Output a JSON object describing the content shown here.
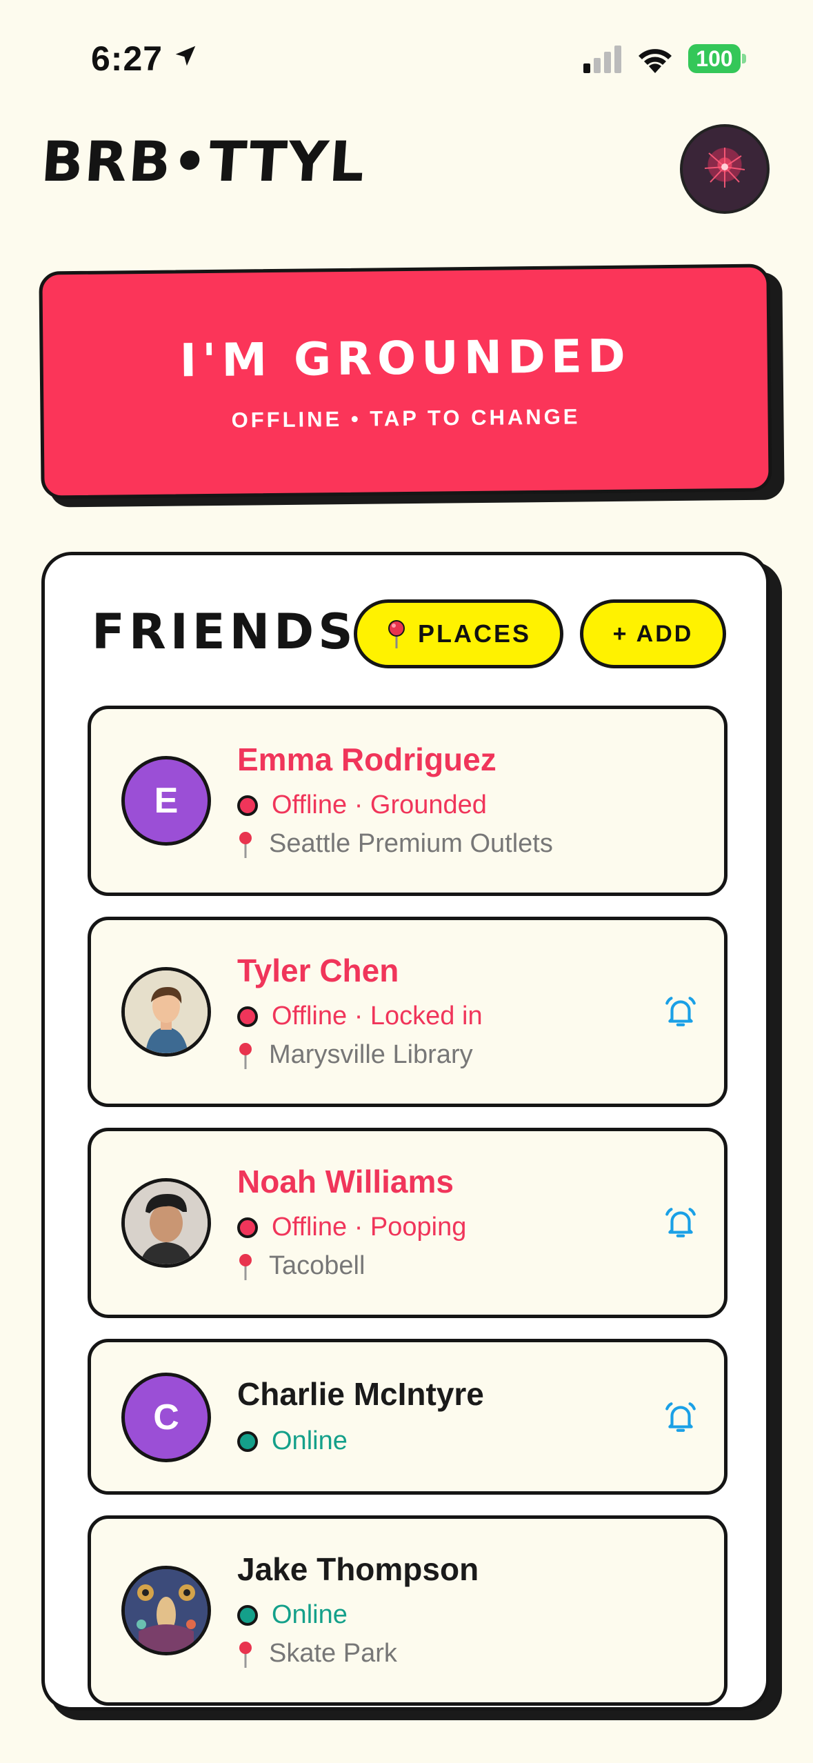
{
  "status_bar": {
    "time": "6:27",
    "battery": "100"
  },
  "header": {
    "title": "BRB•TTYL"
  },
  "status_card": {
    "title": "I'M GROUNDED",
    "subtitle": "OFFLINE • TAP TO CHANGE",
    "color": "#fb3559"
  },
  "friends_panel": {
    "title": "FRIENDS",
    "places_label": "PLACES",
    "add_label": "+ ADD"
  },
  "friends": [
    {
      "name": "Emma Rodriguez",
      "status": "Offline · Grounded",
      "location": "Seattle Premium Outlets",
      "online": false,
      "avatar_letter": "E",
      "bell": false
    },
    {
      "name": "Tyler Chen",
      "status": "Offline · Locked in",
      "location": "Marysville Library",
      "online": false,
      "avatar_letter": "",
      "bell": true
    },
    {
      "name": "Noah Williams",
      "status": "Offline · Pooping",
      "location": "Tacobell",
      "online": false,
      "avatar_letter": "",
      "bell": true
    },
    {
      "name": "Charlie McIntyre",
      "status": "Online",
      "location": "",
      "online": true,
      "avatar_letter": "C",
      "bell": true
    },
    {
      "name": "Jake Thompson",
      "status": "Online",
      "location": "Skate Park",
      "online": true,
      "avatar_letter": "",
      "bell": false
    }
  ],
  "colors": {
    "offline": "#f0355a",
    "online": "#14a08a",
    "pill": "#fff200",
    "bell": "#1aa0e6",
    "background": "#fdfbee"
  },
  "icons": {
    "location_arrow": "location-arrow-icon",
    "pin": "map-pin-icon",
    "bell": "bell-icon"
  }
}
